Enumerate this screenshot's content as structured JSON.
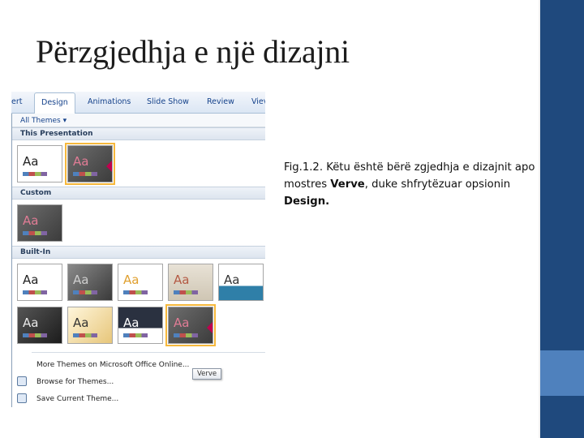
{
  "slide": {
    "title": "Përzgjedhja e një dizajni",
    "caption_part1": "Fig.1.2. Këtu është bërë zgjedhja e dizajnit apo mostres ",
    "caption_bold1": "Verve",
    "caption_part2": ", duke shfrytëzuar opsionin ",
    "caption_bold2": "Design.",
    "colors": {
      "band": "#1f497d",
      "band_accent": "#4f81bd"
    }
  },
  "ribbon": {
    "tabs": [
      {
        "label": "ert"
      },
      {
        "label": "Design",
        "active": true
      },
      {
        "label": "Animations"
      },
      {
        "label": "Slide Show"
      },
      {
        "label": "Review"
      },
      {
        "label": "Viev"
      }
    ]
  },
  "gallery": {
    "filter_label": "All Themes ▾",
    "sections": {
      "this_presentation": "This Presentation",
      "custom": "Custom",
      "built_in": "Built-In"
    },
    "thumb_text": "Aa",
    "tooltip": "Verve",
    "menu": {
      "more_themes": "More Themes on Microsoft Office Online...",
      "browse": "Browse for Themes...",
      "save": "Save Current Theme..."
    }
  }
}
